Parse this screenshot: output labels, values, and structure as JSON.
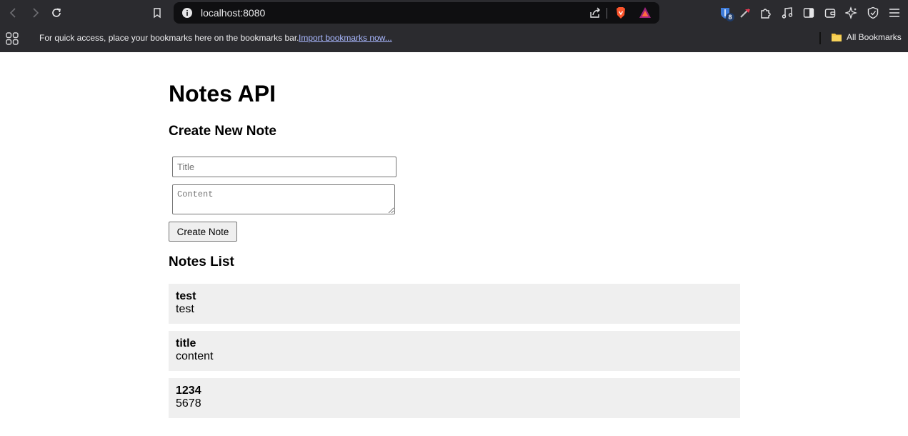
{
  "browser": {
    "url": "localhost:8080",
    "extension_badge": "8",
    "bookmarks_bar": {
      "message": "For quick access, place your bookmarks here on the bookmarks bar.",
      "import_link": "Import bookmarks now...",
      "all_bookmarks": "All Bookmarks"
    },
    "icons": [
      "back-icon",
      "forward-icon",
      "reload-icon",
      "bookmark-icon",
      "site-info-icon",
      "share-icon",
      "brave-shields-icon",
      "brave-rewards-icon",
      "bitwarden-icon",
      "extension-icon",
      "puzzle-icon",
      "music-icon",
      "sidebar-icon",
      "wallet-icon",
      "leo-ai-icon",
      "vpn-icon",
      "menu-icon",
      "apps-icon",
      "folder-icon"
    ]
  },
  "page": {
    "title": "Notes API",
    "create_heading": "Create New Note",
    "form": {
      "title_placeholder": "Title",
      "content_placeholder": "Content",
      "submit_label": "Create Note"
    },
    "list_heading": "Notes List",
    "notes": [
      {
        "title": "test",
        "content": "test"
      },
      {
        "title": "title",
        "content": "content"
      },
      {
        "title": "1234",
        "content": "5678"
      }
    ]
  }
}
